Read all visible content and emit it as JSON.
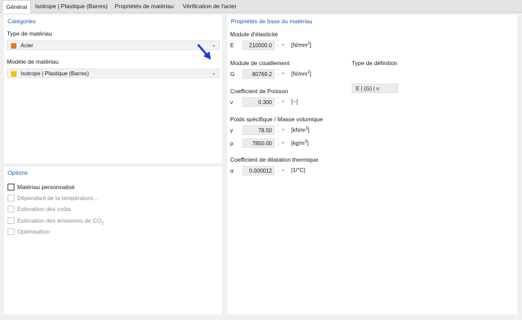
{
  "tabs": [
    {
      "label": "Général",
      "active": true
    },
    {
      "label": "Isotrope | Plastique (Barres)"
    },
    {
      "label": "Propriétés de matériau"
    },
    {
      "label": "Vérification de l'acier"
    }
  ],
  "categories": {
    "title": "Catégories",
    "material_type_label": "Type de matériau",
    "material_type_value": "Acier",
    "material_type_color": "#e8792b",
    "material_model_label": "Modèle de matériau",
    "material_model_value": "Isotrope | Plastique (Barres)",
    "material_model_color": "#f5c400"
  },
  "options": {
    "title": "Options",
    "items": [
      {
        "label": "Matériau personnalisé",
        "checked": false,
        "enabled": true
      },
      {
        "label": "Dépendant de la température...",
        "checked": false,
        "enabled": false
      },
      {
        "label": "Estimation des coûts",
        "checked": false,
        "enabled": false
      },
      {
        "label": "Estimation des émissions de CO",
        "sub": "2",
        "checked": false,
        "enabled": false
      },
      {
        "label": "Optimisation",
        "checked": false,
        "enabled": false
      }
    ]
  },
  "props": {
    "title": "Propriétés de base du matériau",
    "elasticity": {
      "heading": "Module d'élasticité",
      "symbol": "E",
      "value": "210000.0",
      "unit": "[N/mm",
      "unit_sup": "2",
      "unit_end": "]"
    },
    "shear": {
      "heading": "Module de cisaillement",
      "symbol": "G",
      "value": "80769.2",
      "unit": "[N/mm",
      "unit_sup": "2",
      "unit_end": "]"
    },
    "definition": {
      "heading": "Type de définition",
      "value": "E | (G) | ν"
    },
    "poisson": {
      "heading": "Coefficient de Poisson",
      "symbol": "ν",
      "value": "0.300",
      "unit": "[--]"
    },
    "weight": {
      "heading": "Poids spécifique / Masse volumique",
      "gamma": {
        "symbol": "γ",
        "value": "78.50",
        "unit": "[kN/m",
        "unit_sup": "3",
        "unit_end": "]"
      },
      "rho": {
        "symbol": "ρ",
        "value": "7850.00",
        "unit": "[kg/m",
        "unit_sup": "3",
        "unit_end": "]"
      }
    },
    "thermal": {
      "heading": "Coefficient de dilatation thermique",
      "symbol": "α",
      "value": "0.000012",
      "unit": "[1/°C]"
    }
  },
  "icons": {
    "spinner": "spinner-icon",
    "arrow": "arrow-right-icon",
    "chevron": "chevron-down-icon",
    "pointer": "blue-pointer-arrow-icon"
  },
  "colors": {
    "accent": "#1f5ea8",
    "pointer": "#1a3ce0"
  }
}
